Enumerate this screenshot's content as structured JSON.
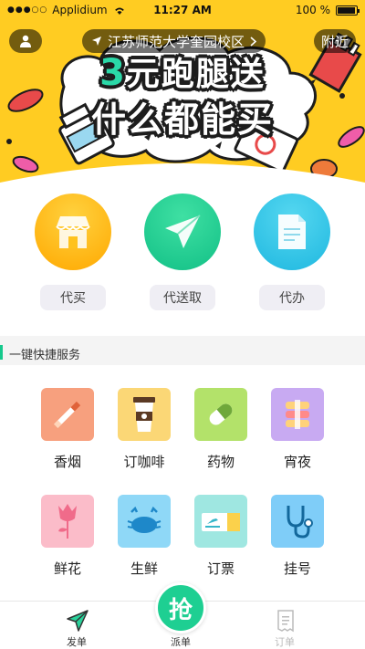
{
  "status_bar": {
    "carrier": "Applidium",
    "time": "11:27 AM",
    "battery": "100 %"
  },
  "header": {
    "location": "江苏师范大学奎园校区",
    "nearby_label": "附近"
  },
  "banner": {
    "slogan_number": "3",
    "slogan_line1": "元跑腿送",
    "slogan_line2": "什么都能买",
    "pages": 2,
    "active_page": 0
  },
  "services": [
    {
      "label": "代买",
      "icon": "store-icon",
      "color": "#ffb300"
    },
    {
      "label": "代送取",
      "icon": "paper-plane-icon",
      "color": "#1fd08f"
    },
    {
      "label": "代办",
      "icon": "document-icon",
      "color": "#2ec5e8"
    }
  ],
  "quick_services": {
    "title": "一键快捷服务",
    "items": [
      {
        "label": "香烟",
        "icon": "cigarette-icon",
        "color": "#f7a07e"
      },
      {
        "label": "订咖啡",
        "icon": "coffee-icon",
        "color": "#fbd776"
      },
      {
        "label": "药物",
        "icon": "pill-icon",
        "color": "#b3e26a"
      },
      {
        "label": "宵夜",
        "icon": "night-snack-icon",
        "color": "#c8aaf2"
      },
      {
        "label": "鲜花",
        "icon": "flower-icon",
        "color": "#fbbcc9"
      },
      {
        "label": "生鲜",
        "icon": "crab-icon",
        "color": "#8fd8f7"
      },
      {
        "label": "订票",
        "icon": "ticket-icon",
        "color": "#9fe7e1"
      },
      {
        "label": "挂号",
        "icon": "stethoscope-icon",
        "color": "#7fcdf8"
      }
    ]
  },
  "tabbar": {
    "send_label": "发单",
    "dispatch_label": "派单",
    "orders_label": "订单",
    "grab_label": "抢",
    "active_color": "#333333",
    "inactive_color": "#bbbbbb"
  }
}
